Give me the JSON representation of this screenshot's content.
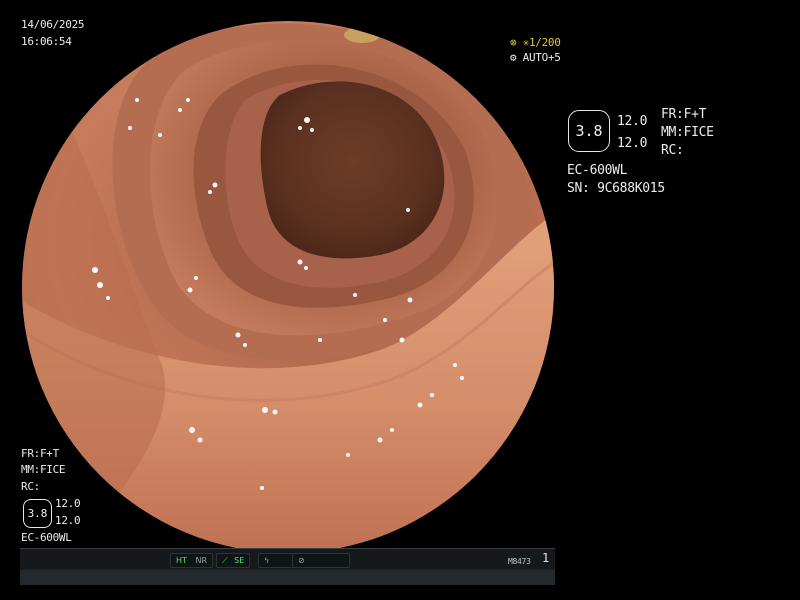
{
  "overlay": {
    "date": "14/06/2025",
    "time": "16:06:54",
    "shutter": "1/200",
    "exposure": "AUTO+5",
    "shutter_icon": "star-icon",
    "exposure_icon": "iris-icon"
  },
  "right_panel": {
    "hex_value": "3.8",
    "value_top": "12.0",
    "value_bottom": "12.0",
    "fr": "FR:F+T",
    "mm": "MM:FICE",
    "rc": "RC:",
    "scope_model": "EC-600WL",
    "serial": "SN: 9C688K015"
  },
  "left_panel": {
    "fr": "FR:F+T",
    "mm": "MM:FICE",
    "rc": "RC:",
    "hex_value": "3.8",
    "value_top": "12.0",
    "value_bottom": "12.0",
    "scope_model": "EC-600WL"
  },
  "status_bar": {
    "ht": "HT",
    "nr": "NR",
    "se": "SE",
    "code": "M8473",
    "count": "1"
  },
  "colors": {
    "tissue": "#c77a5c",
    "lumen": "#5a3222",
    "highlight": "#ffffff",
    "accent_green": "#4fe06a",
    "accent_yellow": "#d9c83a"
  }
}
